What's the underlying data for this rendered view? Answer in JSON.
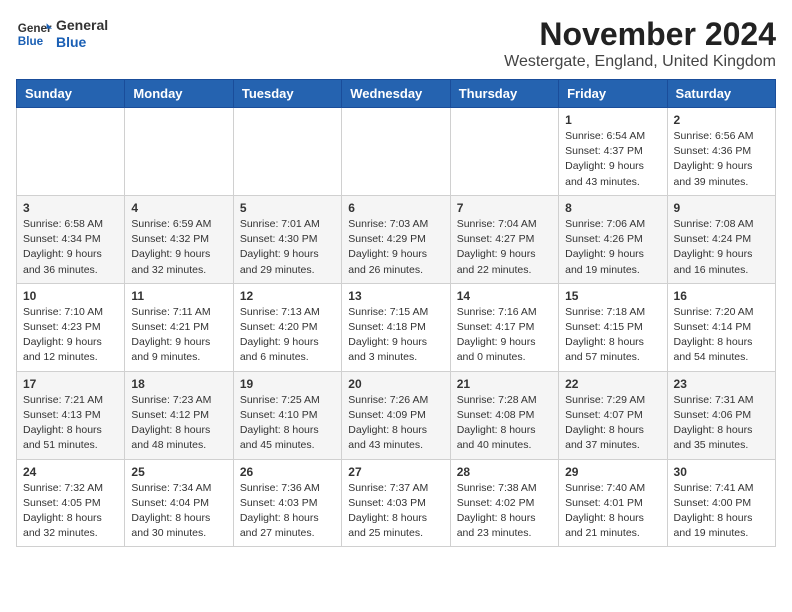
{
  "header": {
    "logo_line1": "General",
    "logo_line2": "Blue",
    "month_title": "November 2024",
    "location": "Westergate, England, United Kingdom"
  },
  "weekdays": [
    "Sunday",
    "Monday",
    "Tuesday",
    "Wednesday",
    "Thursday",
    "Friday",
    "Saturday"
  ],
  "weeks": [
    [
      {
        "day": "",
        "info": ""
      },
      {
        "day": "",
        "info": ""
      },
      {
        "day": "",
        "info": ""
      },
      {
        "day": "",
        "info": ""
      },
      {
        "day": "",
        "info": ""
      },
      {
        "day": "1",
        "info": "Sunrise: 6:54 AM\nSunset: 4:37 PM\nDaylight: 9 hours\nand 43 minutes."
      },
      {
        "day": "2",
        "info": "Sunrise: 6:56 AM\nSunset: 4:36 PM\nDaylight: 9 hours\nand 39 minutes."
      }
    ],
    [
      {
        "day": "3",
        "info": "Sunrise: 6:58 AM\nSunset: 4:34 PM\nDaylight: 9 hours\nand 36 minutes."
      },
      {
        "day": "4",
        "info": "Sunrise: 6:59 AM\nSunset: 4:32 PM\nDaylight: 9 hours\nand 32 minutes."
      },
      {
        "day": "5",
        "info": "Sunrise: 7:01 AM\nSunset: 4:30 PM\nDaylight: 9 hours\nand 29 minutes."
      },
      {
        "day": "6",
        "info": "Sunrise: 7:03 AM\nSunset: 4:29 PM\nDaylight: 9 hours\nand 26 minutes."
      },
      {
        "day": "7",
        "info": "Sunrise: 7:04 AM\nSunset: 4:27 PM\nDaylight: 9 hours\nand 22 minutes."
      },
      {
        "day": "8",
        "info": "Sunrise: 7:06 AM\nSunset: 4:26 PM\nDaylight: 9 hours\nand 19 minutes."
      },
      {
        "day": "9",
        "info": "Sunrise: 7:08 AM\nSunset: 4:24 PM\nDaylight: 9 hours\nand 16 minutes."
      }
    ],
    [
      {
        "day": "10",
        "info": "Sunrise: 7:10 AM\nSunset: 4:23 PM\nDaylight: 9 hours\nand 12 minutes."
      },
      {
        "day": "11",
        "info": "Sunrise: 7:11 AM\nSunset: 4:21 PM\nDaylight: 9 hours\nand 9 minutes."
      },
      {
        "day": "12",
        "info": "Sunrise: 7:13 AM\nSunset: 4:20 PM\nDaylight: 9 hours\nand 6 minutes."
      },
      {
        "day": "13",
        "info": "Sunrise: 7:15 AM\nSunset: 4:18 PM\nDaylight: 9 hours\nand 3 minutes."
      },
      {
        "day": "14",
        "info": "Sunrise: 7:16 AM\nSunset: 4:17 PM\nDaylight: 9 hours\nand 0 minutes."
      },
      {
        "day": "15",
        "info": "Sunrise: 7:18 AM\nSunset: 4:15 PM\nDaylight: 8 hours\nand 57 minutes."
      },
      {
        "day": "16",
        "info": "Sunrise: 7:20 AM\nSunset: 4:14 PM\nDaylight: 8 hours\nand 54 minutes."
      }
    ],
    [
      {
        "day": "17",
        "info": "Sunrise: 7:21 AM\nSunset: 4:13 PM\nDaylight: 8 hours\nand 51 minutes."
      },
      {
        "day": "18",
        "info": "Sunrise: 7:23 AM\nSunset: 4:12 PM\nDaylight: 8 hours\nand 48 minutes."
      },
      {
        "day": "19",
        "info": "Sunrise: 7:25 AM\nSunset: 4:10 PM\nDaylight: 8 hours\nand 45 minutes."
      },
      {
        "day": "20",
        "info": "Sunrise: 7:26 AM\nSunset: 4:09 PM\nDaylight: 8 hours\nand 43 minutes."
      },
      {
        "day": "21",
        "info": "Sunrise: 7:28 AM\nSunset: 4:08 PM\nDaylight: 8 hours\nand 40 minutes."
      },
      {
        "day": "22",
        "info": "Sunrise: 7:29 AM\nSunset: 4:07 PM\nDaylight: 8 hours\nand 37 minutes."
      },
      {
        "day": "23",
        "info": "Sunrise: 7:31 AM\nSunset: 4:06 PM\nDaylight: 8 hours\nand 35 minutes."
      }
    ],
    [
      {
        "day": "24",
        "info": "Sunrise: 7:32 AM\nSunset: 4:05 PM\nDaylight: 8 hours\nand 32 minutes."
      },
      {
        "day": "25",
        "info": "Sunrise: 7:34 AM\nSunset: 4:04 PM\nDaylight: 8 hours\nand 30 minutes."
      },
      {
        "day": "26",
        "info": "Sunrise: 7:36 AM\nSunset: 4:03 PM\nDaylight: 8 hours\nand 27 minutes."
      },
      {
        "day": "27",
        "info": "Sunrise: 7:37 AM\nSunset: 4:03 PM\nDaylight: 8 hours\nand 25 minutes."
      },
      {
        "day": "28",
        "info": "Sunrise: 7:38 AM\nSunset: 4:02 PM\nDaylight: 8 hours\nand 23 minutes."
      },
      {
        "day": "29",
        "info": "Sunrise: 7:40 AM\nSunset: 4:01 PM\nDaylight: 8 hours\nand 21 minutes."
      },
      {
        "day": "30",
        "info": "Sunrise: 7:41 AM\nSunset: 4:00 PM\nDaylight: 8 hours\nand 19 minutes."
      }
    ]
  ]
}
